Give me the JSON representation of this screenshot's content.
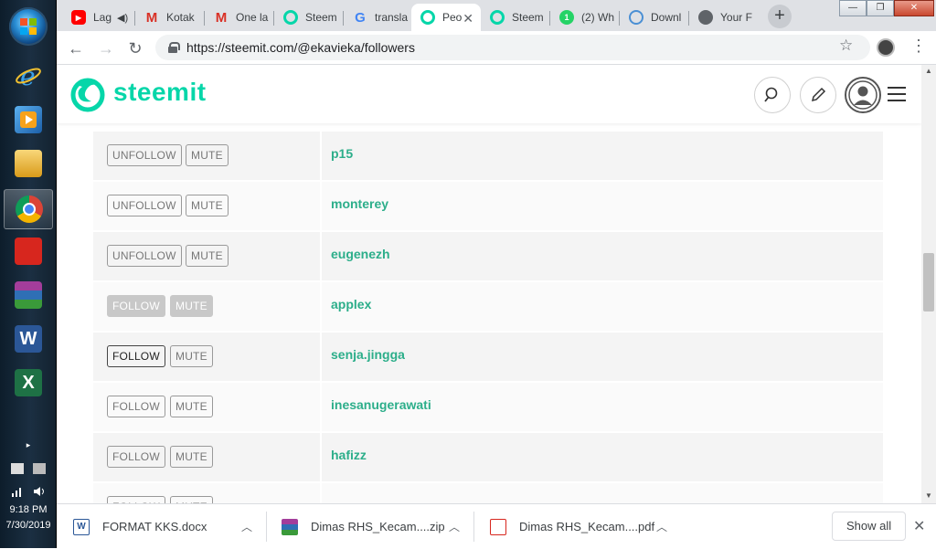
{
  "taskbar": {
    "time": "9:18 PM",
    "date": "7/30/2019",
    "apps": [
      "Internet Explorer",
      "Media Player",
      "Windows Explorer",
      "Google Chrome",
      "Acrobat",
      "WinRAR",
      "Word",
      "Excel"
    ]
  },
  "browser": {
    "tabs": [
      {
        "label": "Lag",
        "favicon": "youtube-icon",
        "audio": true
      },
      {
        "label": "Kotak",
        "favicon": "gmail-icon"
      },
      {
        "label": "One la",
        "favicon": "gmail-icon"
      },
      {
        "label": "Steem",
        "favicon": "steemit-icon"
      },
      {
        "label": "transla",
        "favicon": "google-icon"
      },
      {
        "label": "Peo",
        "favicon": "steemit-icon",
        "active": true
      },
      {
        "label": "Steem",
        "favicon": "steemit-icon"
      },
      {
        "label": "(2) Wh",
        "favicon": "whatsapp-icon"
      },
      {
        "label": "Downl",
        "favicon": "download-site-icon"
      },
      {
        "label": "Your F",
        "favicon": "globe-icon"
      }
    ],
    "url": "https://steemit.com/@ekavieka/followers"
  },
  "site": {
    "brand": "steemit",
    "brand_color": "#06d6a9",
    "link_color": "#2cae8a"
  },
  "followers": [
    {
      "username": "p15",
      "follow_label": "UNFOLLOW",
      "mute_label": "MUTE",
      "state": "following"
    },
    {
      "username": "monterey",
      "follow_label": "UNFOLLOW",
      "mute_label": "MUTE",
      "state": "following"
    },
    {
      "username": "eugenezh",
      "follow_label": "UNFOLLOW",
      "mute_label": "MUTE",
      "state": "following"
    },
    {
      "username": "applex",
      "follow_label": "FOLLOW",
      "mute_label": "MUTE",
      "state": "disabled"
    },
    {
      "username": "senja.jingga",
      "follow_label": "FOLLOW",
      "mute_label": "MUTE",
      "state": "hover"
    },
    {
      "username": "inesanugerawati",
      "follow_label": "FOLLOW",
      "mute_label": "MUTE",
      "state": "normal"
    },
    {
      "username": "hafizz",
      "follow_label": "FOLLOW",
      "mute_label": "MUTE",
      "state": "normal"
    },
    {
      "username": "",
      "follow_label": "FOLLOW",
      "mute_label": "MUTE",
      "state": "normal"
    }
  ],
  "downloads": {
    "items": [
      {
        "name": "FORMAT KKS.docx",
        "type": "word"
      },
      {
        "name": "Dimas RHS_Kecam....zip",
        "type": "zip"
      },
      {
        "name": "Dimas RHS_Kecam....pdf",
        "type": "pdf"
      }
    ],
    "show_all_label": "Show all"
  }
}
